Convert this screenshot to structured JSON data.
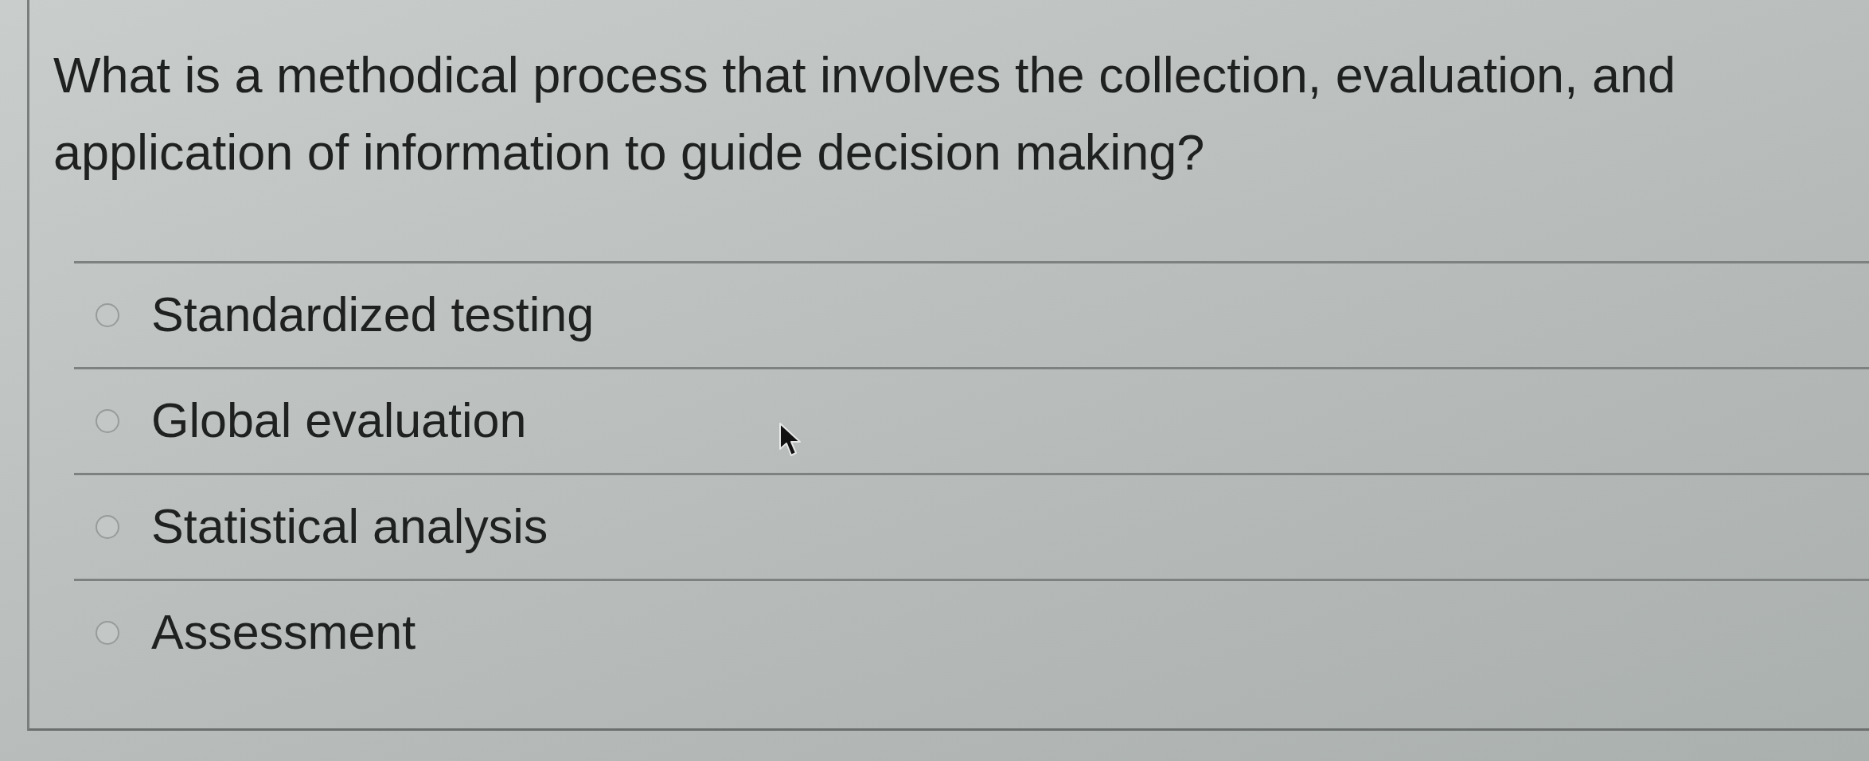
{
  "question": {
    "text": "What is a methodical process that involves the collection, evaluation, and application of information to guide decision making?"
  },
  "options": [
    {
      "label": "Standardized testing",
      "selected": false
    },
    {
      "label": "Global evaluation",
      "selected": false
    },
    {
      "label": "Statistical analysis",
      "selected": false
    },
    {
      "label": "Assessment",
      "selected": false
    }
  ]
}
